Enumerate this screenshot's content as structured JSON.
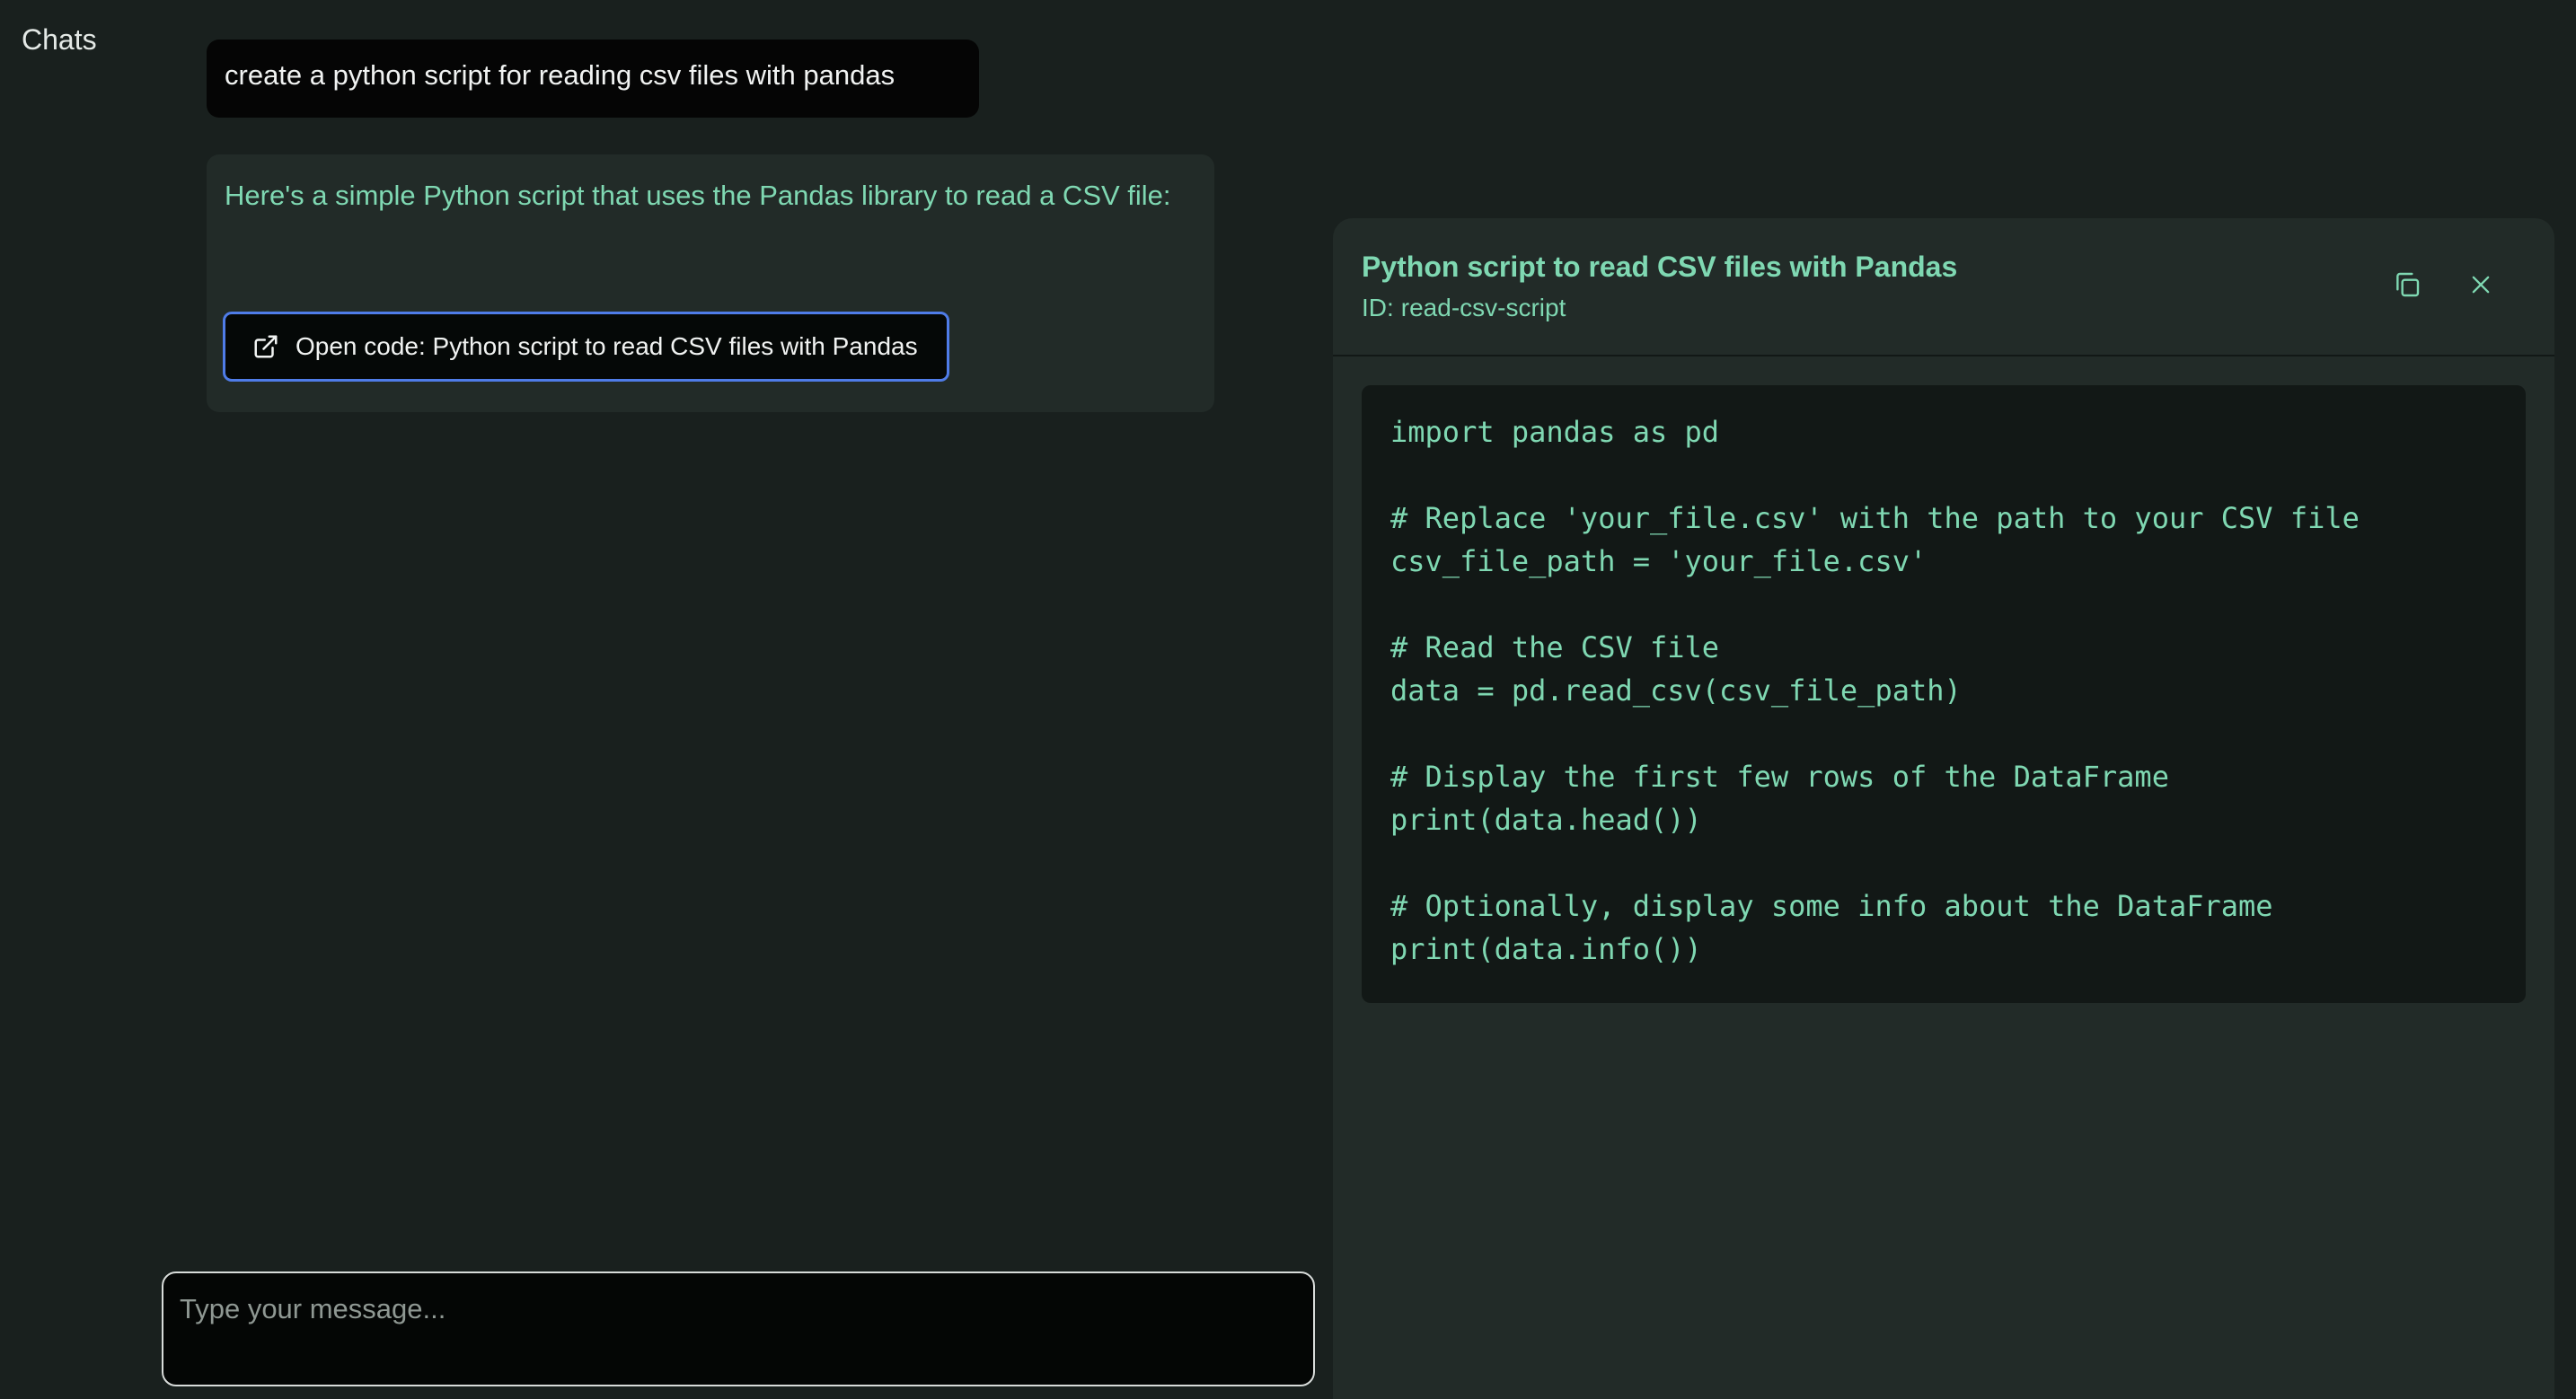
{
  "sidebar": {
    "title": "Chats"
  },
  "chat": {
    "user_message": "create a python script for reading csv files with pandas",
    "assistant_message": "Here's a simple Python script that uses the Pandas library to read a CSV file:",
    "open_code_button_label": "Open code: Python script to read CSV files with Pandas",
    "open_code_icon": "external-link-icon"
  },
  "composer": {
    "placeholder": "Type your message...",
    "value": ""
  },
  "code_panel": {
    "title": "Python script to read CSV files with Pandas",
    "id_label": "ID:",
    "id_value": "read-csv-script",
    "copy_icon": "copy-icon",
    "close_icon": "close-icon",
    "code_lines": [
      "import pandas as pd",
      "",
      "# Replace 'your_file.csv' with the path to your CSV file",
      "csv_file_path = 'your_file.csv'",
      "",
      "# Read the CSV file",
      "data = pd.read_csv(csv_file_path)",
      "",
      "# Display the first few rows of the DataFrame",
      "print(data.head())",
      "",
      "# Optionally, display some info about the DataFrame",
      "print(data.info())"
    ]
  },
  "colors": {
    "background": "#19201e",
    "panel": "#222b28",
    "code_background": "#121816",
    "accent_green": "#7fd8b2",
    "focus_blue": "#4f7ce8"
  }
}
